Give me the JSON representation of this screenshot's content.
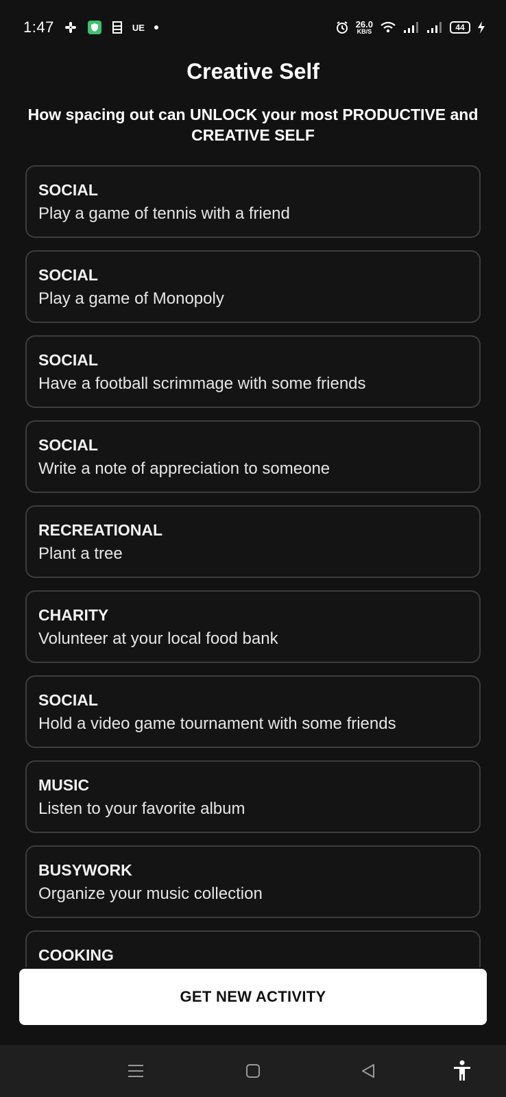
{
  "status_bar": {
    "time": "1:47",
    "left_icons": [
      "slack-icon",
      "shield-app-icon",
      "calendar-icon"
    ],
    "ue_text": "UE",
    "speed_value": "26.0",
    "speed_unit": "KB/S",
    "battery": "44"
  },
  "header": {
    "title": "Creative Self",
    "subtitle": "How spacing out can UNLOCK your most PRODUCTIVE and CREATIVE SELF"
  },
  "activities": [
    {
      "type": "SOCIAL",
      "description": "Play a game of tennis with a friend"
    },
    {
      "type": "SOCIAL",
      "description": "Play a game of Monopoly"
    },
    {
      "type": "SOCIAL",
      "description": "Have a football scrimmage with some friends"
    },
    {
      "type": "SOCIAL",
      "description": "Write a note of appreciation to someone"
    },
    {
      "type": "RECREATIONAL",
      "description": "Plant a tree"
    },
    {
      "type": "CHARITY",
      "description": "Volunteer at your local food bank"
    },
    {
      "type": "SOCIAL",
      "description": "Hold a video game tournament with some friends"
    },
    {
      "type": "MUSIC",
      "description": "Listen to your favorite album"
    },
    {
      "type": "BUSYWORK",
      "description": "Organize your music collection"
    },
    {
      "type": "COOKING",
      "description": ""
    }
  ],
  "primary_button": {
    "label": "GET NEW ACTIVITY"
  },
  "nav_bar": {
    "icons": [
      "menu-icon",
      "home-square-icon",
      "back-triangle-icon",
      "accessibility-icon"
    ]
  },
  "colors": {
    "background": "#121212",
    "card_border": "#3d3d3d",
    "button_bg": "#ffffff",
    "nav_bg": "#1f1f1f"
  }
}
